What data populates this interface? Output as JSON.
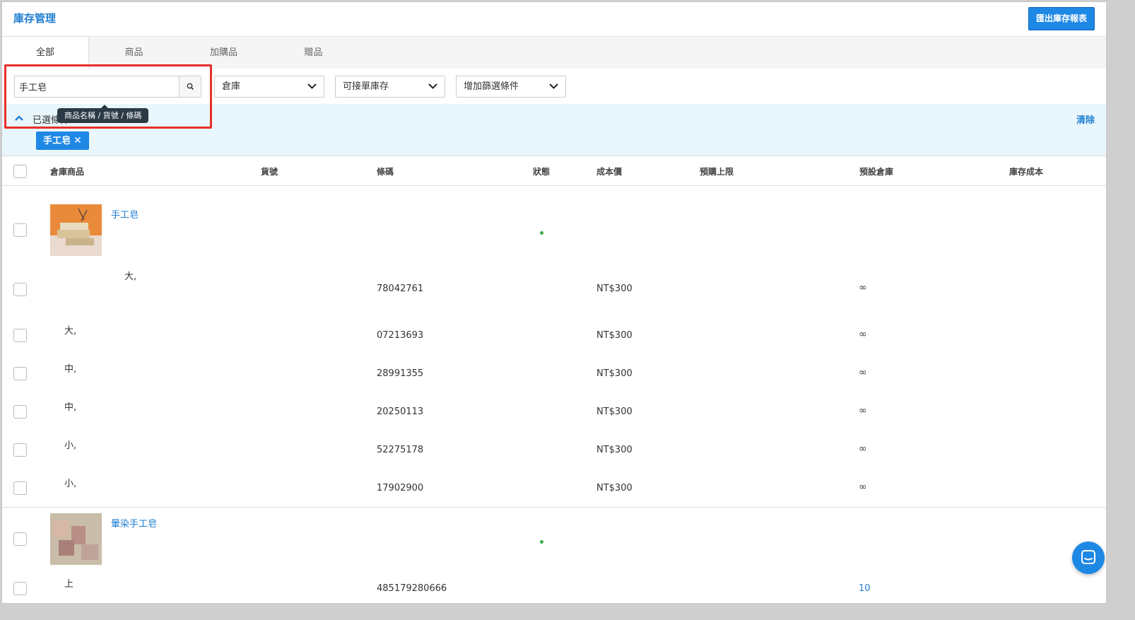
{
  "header": {
    "title": "庫存管理",
    "export_label": "匯出庫存報表"
  },
  "tabs": [
    {
      "label": "全部",
      "active": true
    },
    {
      "label": "商品",
      "active": false
    },
    {
      "label": "加購品",
      "active": false
    },
    {
      "label": "贈品",
      "active": false
    }
  ],
  "filters": {
    "search_value": "手工皂",
    "search_tooltip": "商品名稱 / 貨號 / 條碼",
    "warehouse_label": "倉庫",
    "stock_label": "可接單庫存",
    "more_filters_label": "增加篩選條件"
  },
  "selected": {
    "label": "已選條件",
    "clear_label": "清除",
    "chip_label": "手工皂"
  },
  "table": {
    "columns": [
      "倉庫商品",
      "貨號",
      "條碼",
      "狀態",
      "成本價",
      "預購上限",
      "預設倉庫",
      "庫存成本"
    ],
    "products": [
      {
        "name": "手工皂",
        "variants": [
          {
            "spec": "大,",
            "barcode": "78042761",
            "cost": "NT$300",
            "stock": "∞"
          },
          {
            "spec": "大,",
            "barcode": "07213693",
            "cost": "NT$300",
            "stock": "∞"
          },
          {
            "spec": "中,",
            "barcode": "28991355",
            "cost": "NT$300",
            "stock": "∞"
          },
          {
            "spec": "中,",
            "barcode": "20250113",
            "cost": "NT$300",
            "stock": "∞"
          },
          {
            "spec": "小,",
            "barcode": "52275178",
            "cost": "NT$300",
            "stock": "∞"
          },
          {
            "spec": "小,",
            "barcode": "17902900",
            "cost": "NT$300",
            "stock": "∞"
          }
        ]
      },
      {
        "name": "暈染手工皂",
        "variants": [
          {
            "spec": "上",
            "barcode": "485179280666",
            "cost": "",
            "stock": "10"
          }
        ]
      }
    ]
  },
  "colors": {
    "accent": "#1e88e5",
    "link": "#1f7fd1",
    "highlight": "#e62f2a",
    "status_active": "#3fae49",
    "selected_bg": "#e9f7fc"
  }
}
